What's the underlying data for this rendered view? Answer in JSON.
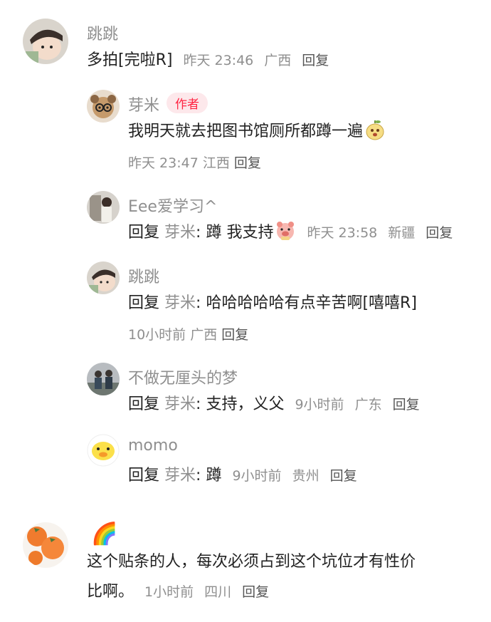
{
  "comments": [
    {
      "name": "跳跳",
      "text": "多拍[完啦R]",
      "time": "昨天 23:46",
      "location": "广西",
      "reply": "回复",
      "replies": [
        {
          "name": "芽米",
          "badge": "作者",
          "text": "我明天就去把图书馆厕所都蹲一遍",
          "time": "昨天 23:47",
          "location": "江西",
          "reply": "回复"
        },
        {
          "name": "Eee爱学习^",
          "reply_prefix": "回复",
          "mention": "芽米",
          "colon": ":",
          "text": "蹲 我支持",
          "time": "昨天 23:58",
          "location": "新疆",
          "reply": "回复"
        },
        {
          "name": "跳跳",
          "reply_prefix": "回复",
          "mention": "芽米",
          "colon": ":",
          "text": "哈哈哈哈哈有点辛苦啊[嘻嘻R]",
          "time": "10小时前",
          "location": "广西",
          "reply": "回复"
        },
        {
          "name": "不做无厘头的梦",
          "reply_prefix": "回复",
          "mention": "芽米",
          "colon": ":",
          "text": "支持，义父",
          "time": "9小时前",
          "location": "广东",
          "reply": "回复"
        },
        {
          "name": "momo",
          "reply_prefix": "回复",
          "mention": "芽米",
          "colon": ":",
          "text": "蹲",
          "time": "9小时前",
          "location": "贵州",
          "reply": "回复"
        }
      ]
    },
    {
      "name": "🌈",
      "text_line1": "这个贴条的人，每次必须占到这个坑位才有性价",
      "text_line2": "比啊。",
      "time": "1小时前",
      "location": "四川",
      "reply": "回复"
    }
  ],
  "colors": {
    "accent": "#ff2442",
    "muted": "#8f8f8f",
    "text": "#222222"
  }
}
